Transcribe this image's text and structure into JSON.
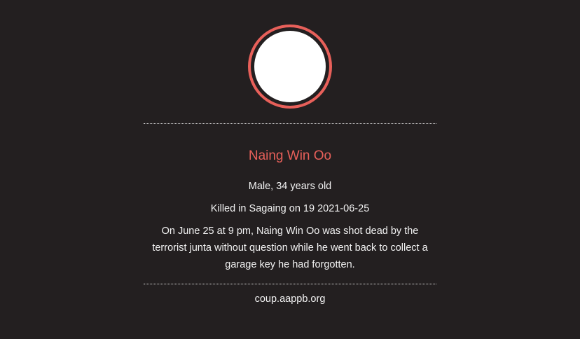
{
  "profile": {
    "name": "Naing Win Oo",
    "gender_age": "Male, 34 years old",
    "death_info": "Killed in Sagaing on 19 2021-06-25",
    "story": "On June 25 at 9 pm, Naing Win Oo was shot dead by the terrorist junta without question while he went back to collect a garage key he had forgotten.",
    "source": "coup.aappb.org"
  },
  "colors": {
    "background": "#231f20",
    "accent": "#e8605a",
    "text": "#f2f2f2"
  }
}
